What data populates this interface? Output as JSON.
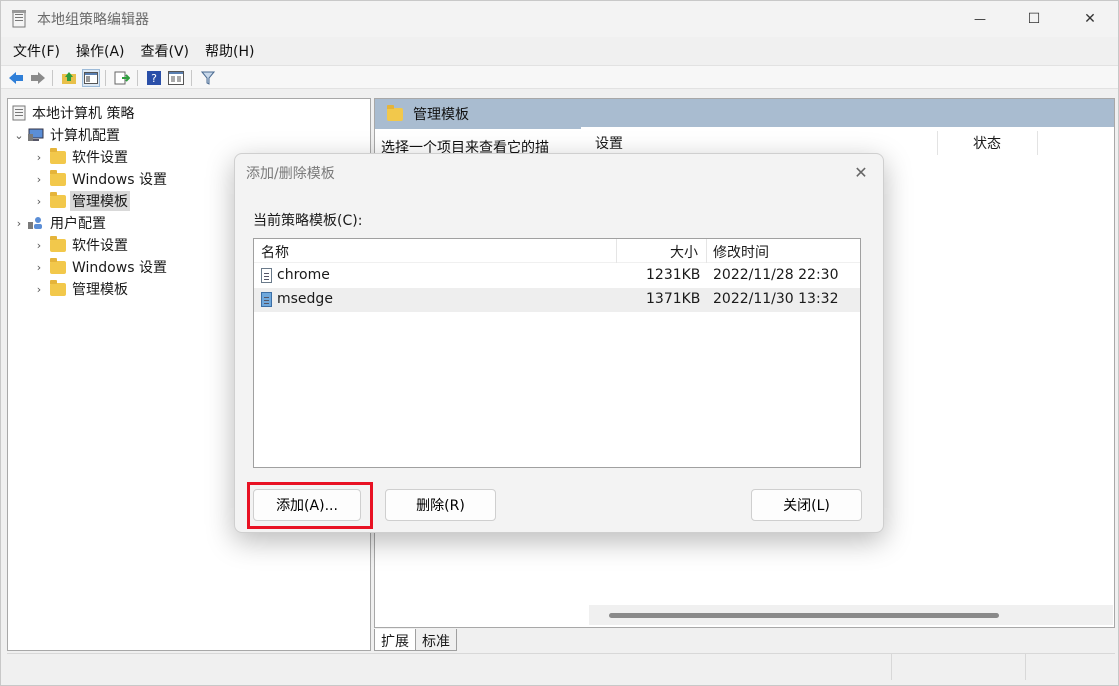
{
  "window": {
    "title": "本地组策略编辑器",
    "controls": {
      "minimize": "—",
      "maximize": "☐",
      "close": "✕"
    }
  },
  "menu": [
    "文件(F)",
    "操作(A)",
    "查看(V)",
    "帮助(H)"
  ],
  "toolbar": {
    "icons": [
      "back-icon",
      "forward-icon",
      "up-folder-icon",
      "show-hide-tree-icon",
      "export-list-icon",
      "help-icon",
      "properties-icon",
      "filter-icon"
    ]
  },
  "tree": {
    "root": "本地计算机 策略",
    "computer": "计算机配置",
    "computer_children": [
      "软件设置",
      "Windows 设置",
      "管理模板"
    ],
    "user": "用户配置",
    "user_children": [
      "软件设置",
      "Windows 设置",
      "管理模板"
    ]
  },
  "right_pane": {
    "header": "管理模板",
    "description": "选择一个项目来查看它的描",
    "columns": [
      "设置",
      "状态"
    ]
  },
  "tabs": [
    "扩展",
    "标准"
  ],
  "dialog": {
    "title": "添加/删除模板",
    "label": "当前策略模板(C):",
    "columns": {
      "name": "名称",
      "size": "大小",
      "modified": "修改时间"
    },
    "rows": [
      {
        "name": "chrome",
        "size": "1231KB",
        "modified": "2022/11/28 22:30"
      },
      {
        "name": "msedge",
        "size": "1371KB",
        "modified": "2022/11/30 13:32"
      }
    ],
    "buttons": {
      "add": "添加(A)...",
      "remove": "删除(R)",
      "close": "关闭(L)"
    },
    "close_glyph": "✕"
  },
  "colors": {
    "highlight": "#e81123",
    "pane_header": "#a9bcd0"
  }
}
